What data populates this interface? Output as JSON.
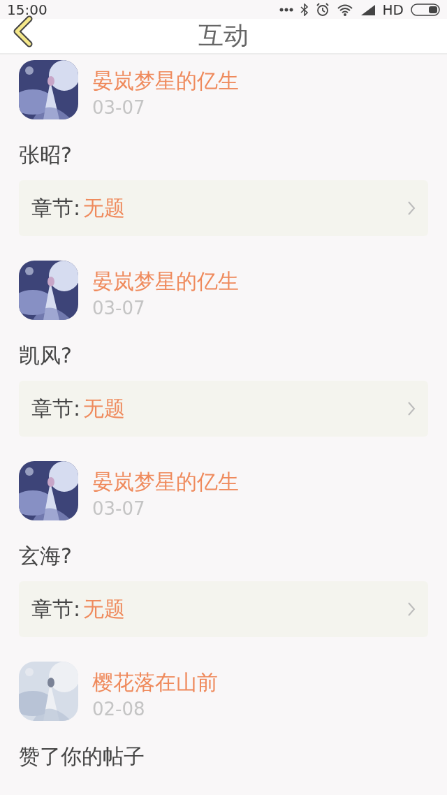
{
  "status_bar": {
    "time": "15:00",
    "network": "HD"
  },
  "header": {
    "title": "互动"
  },
  "items": [
    {
      "kind": "comment",
      "name": "晏岚梦星的亿生",
      "date": "03-07",
      "message": "张昭?",
      "chapter": {
        "label": "章节:",
        "title": "无题"
      }
    },
    {
      "kind": "comment",
      "name": "晏岚梦星的亿生",
      "date": "03-07",
      "message": "凯风?",
      "chapter": {
        "label": "章节:",
        "title": "无题"
      }
    },
    {
      "kind": "comment",
      "name": "晏岚梦星的亿生",
      "date": "03-07",
      "message": "玄海?",
      "chapter": {
        "label": "章节:",
        "title": "无题"
      }
    },
    {
      "kind": "like",
      "name": "樱花落在山前",
      "date": "02-08",
      "message": "赞了你的帖子"
    }
  ]
}
